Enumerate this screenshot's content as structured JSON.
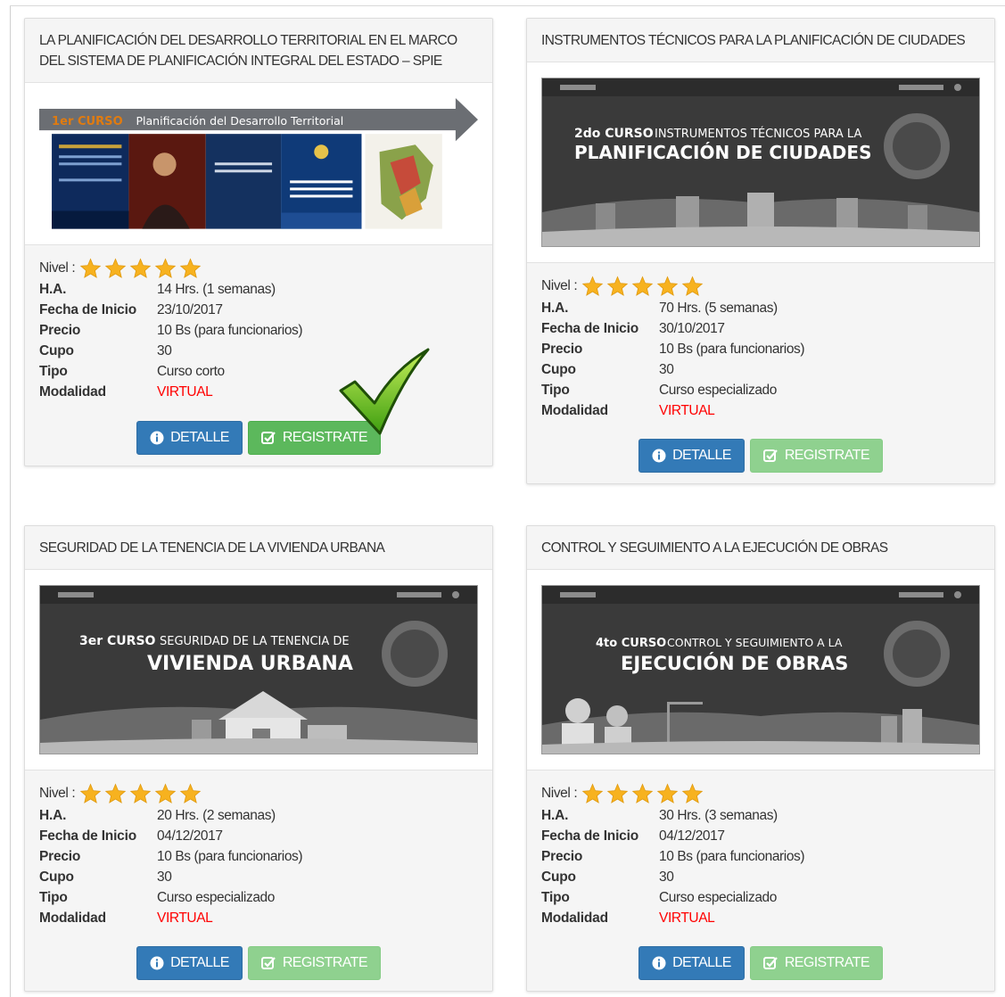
{
  "labels": {
    "nivel": "Nivel :",
    "ha": "H.A.",
    "fecha": "Fecha de Inicio",
    "precio": "Precio",
    "cupo": "Cupo",
    "tipo": "Tipo",
    "modalidad": "Modalidad",
    "detalle": "DETALLE",
    "registrate": "REGISTRATE"
  },
  "icons": [
    "info-circle-icon",
    "check-square-icon",
    "star-icon",
    "checkmark-icon"
  ],
  "colors": {
    "primary": "#337ab7",
    "success": "#5cb85c",
    "success_disabled": "#8fd18f",
    "virtual": "#ff0000",
    "star": "#f7b21f"
  },
  "courses": [
    {
      "title": "LA PLANIFICACIÓN DEL DESARROLLO TERRITORIAL EN EL MARCO DEL SISTEMA DE PLANIFICACIÓN INTEGRAL DEL ESTADO – SPIE",
      "banner": {
        "tag": "1er CURSO",
        "line1": "Planificación del Desarrollo Territorial",
        "line2": ""
      },
      "stars": 5,
      "ha": "14 Hrs. (1 semanas)",
      "fecha": "23/10/2017",
      "precio": "10 Bs (para funcionarios)",
      "cupo": "30",
      "tipo": "Curso corto",
      "modalidad": "VIRTUAL",
      "register_enabled": true
    },
    {
      "title": "INSTRUMENTOS TÉCNICOS PARA LA PLANIFICACIÓN DE CIUDADES",
      "banner": {
        "tag": "2do CURSO",
        "line1": "INSTRUMENTOS TÉCNICOS PARA LA",
        "line2": "PLANIFICACIÓN DE CIUDADES"
      },
      "stars": 5,
      "ha": "70 Hrs. (5 semanas)",
      "fecha": "30/10/2017",
      "precio": "10 Bs (para funcionarios)",
      "cupo": "30",
      "tipo": "Curso especializado",
      "modalidad": "VIRTUAL",
      "register_enabled": false
    },
    {
      "title": "SEGURIDAD DE LA TENENCIA DE LA VIVIENDA URBANA",
      "banner": {
        "tag": "3er CURSO",
        "line1": "SEGURIDAD DE LA TENENCIA DE",
        "line2": "VIVIENDA URBANA"
      },
      "stars": 5,
      "ha": "20 Hrs. (2 semanas)",
      "fecha": "04/12/2017",
      "precio": "10 Bs (para funcionarios)",
      "cupo": "30",
      "tipo": "Curso especializado",
      "modalidad": "VIRTUAL",
      "register_enabled": false
    },
    {
      "title": "CONTROL Y SEGUIMIENTO A LA EJECUCIÓN DE OBRAS",
      "banner": {
        "tag": "4to CURSO",
        "line1": "CONTROL Y SEGUIMIENTO A LA",
        "line2": "EJECUCIÓN DE OBRAS"
      },
      "stars": 5,
      "ha": "30 Hrs. (3 semanas)",
      "fecha": "04/12/2017",
      "precio": "10 Bs (para funcionarios)",
      "cupo": "30",
      "tipo": "Curso especializado",
      "modalidad": "VIRTUAL",
      "register_enabled": false
    }
  ]
}
